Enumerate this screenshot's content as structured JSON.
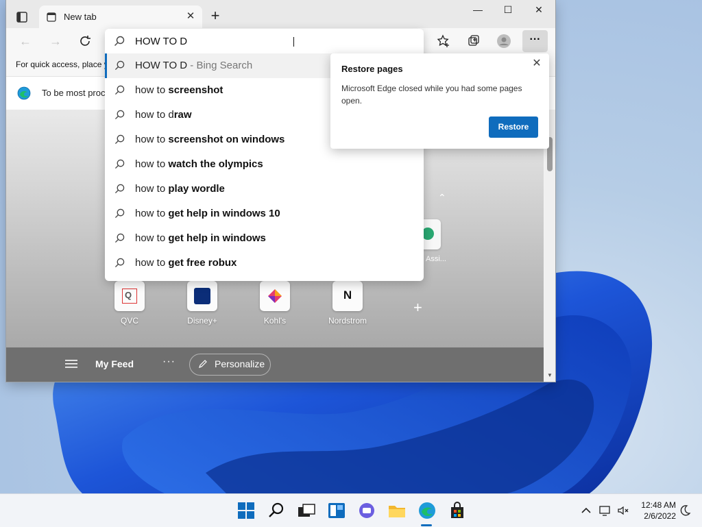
{
  "window": {
    "tab_title": "New tab",
    "minimize": "—",
    "maximize": "☐",
    "close": "✕",
    "new_tab": "+"
  },
  "address": {
    "value": "HOW TO D",
    "suggestions": [
      {
        "prefix": "HOW TO D",
        "rest": " - Bing Search",
        "first": true
      },
      {
        "prefix": "how to ",
        "rest": "screenshot"
      },
      {
        "prefix": "how to d",
        "rest": "raw"
      },
      {
        "prefix": "how to ",
        "rest": "screenshot on windows"
      },
      {
        "prefix": "how to ",
        "rest": "watch the olympics"
      },
      {
        "prefix": "how to ",
        "rest": "play wordle"
      },
      {
        "prefix": "how to ",
        "rest": "get help in windows 10"
      },
      {
        "prefix": "how to ",
        "rest": "get help in windows"
      },
      {
        "prefix": "how to ",
        "rest": "get free robux"
      }
    ]
  },
  "favbar": {
    "text": "For quick access, place y"
  },
  "infobar": {
    "text": "To be most proc"
  },
  "restore_popup": {
    "title": "Restore pages",
    "message": "Microsoft Edge closed while you had some pages open.",
    "button": "Restore"
  },
  "ntp": {
    "partial_tile_label": "Assi...",
    "tiles": [
      {
        "label": "QVC"
      },
      {
        "label": "Disney+"
      },
      {
        "label": "Kohl's"
      },
      {
        "label": "Nordstrom",
        "letter": "N"
      }
    ],
    "feed": {
      "my_feed": "My Feed",
      "dots": "···",
      "personalize": "Personalize"
    }
  },
  "clock": {
    "time": "12:48 AM",
    "date": "2/6/2022"
  },
  "colors": {
    "accent": "#0f6cbd",
    "taskbar": "#f2f4f8"
  }
}
